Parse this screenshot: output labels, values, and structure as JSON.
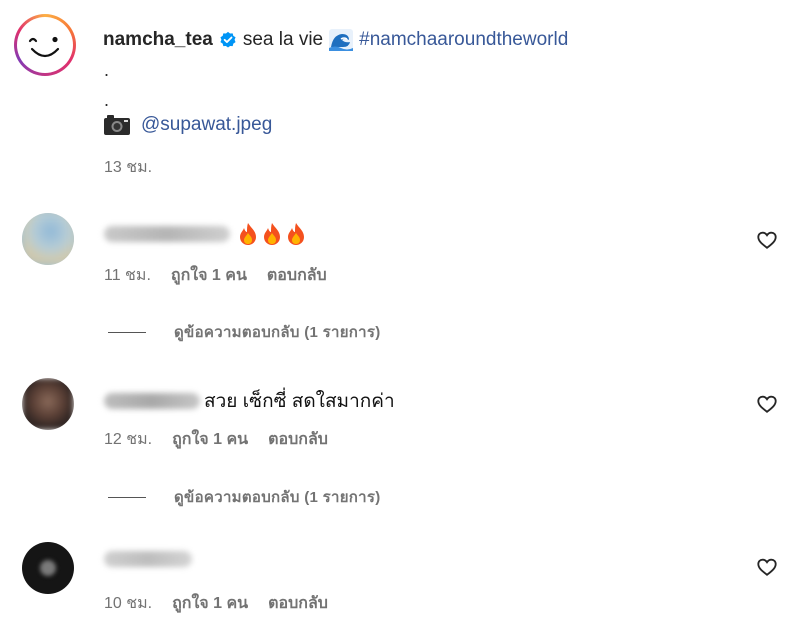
{
  "post": {
    "username": "namcha_tea",
    "caption": "sea la vie",
    "hashtag": "#namchaaroundtheworld",
    "dot1": ".",
    "dot2": ".",
    "photo_credit": "@supawat.jpeg",
    "time": "13 ชม."
  },
  "comments": [
    {
      "username": "ladybrowwww",
      "text": "",
      "emoji": [
        "fire-icon",
        "fire-icon",
        "fire-icon"
      ],
      "time": "11 ชม.",
      "likes": "ถูกใจ 1 คน",
      "reply_label": "ตอบกลับ",
      "view_replies": "ดูข้อความตอบกลับ (1 รายการ)"
    },
    {
      "username": "yingbabb",
      "text": "สวย เซ็กซี่ สดใสมากค่า",
      "time": "12 ชม.",
      "likes": "ถูกใจ 1 คน",
      "reply_label": "ตอบกลับ",
      "view_replies": "ดูข้อความตอบกลับ (1 รายการ)"
    },
    {
      "username": "marco_d",
      "text": "",
      "time": "10 ชม.",
      "likes": "ถูกใจ 1 คน",
      "reply_label": "ตอบกลับ"
    }
  ],
  "colors": {
    "link": "#385898",
    "meta": "#737373",
    "verified": "#0095f6"
  }
}
